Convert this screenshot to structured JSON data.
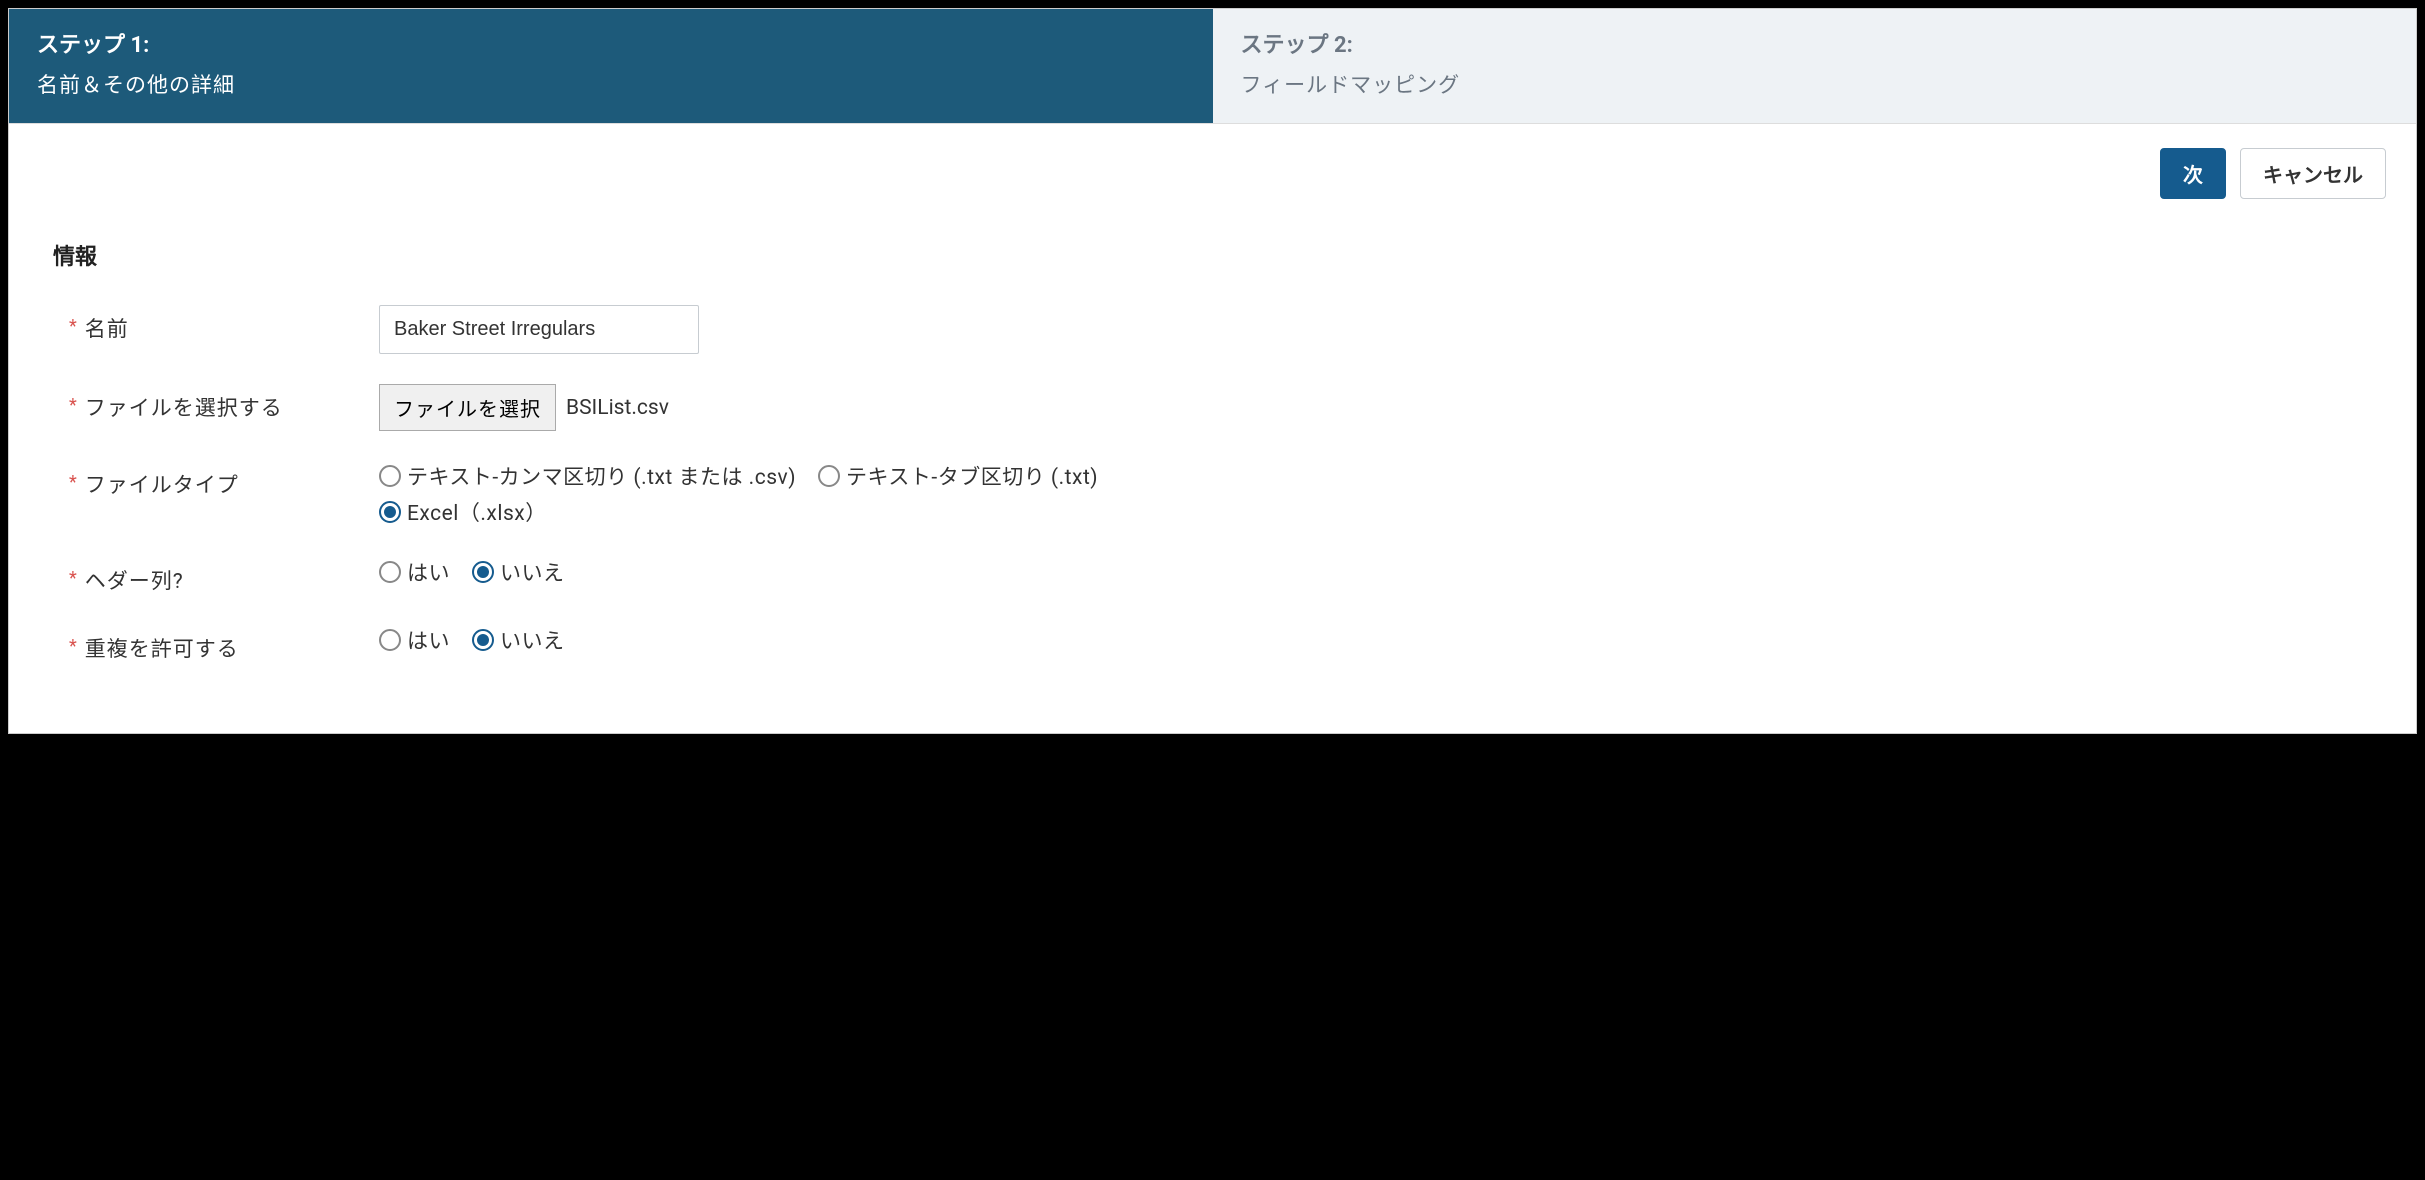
{
  "steps": {
    "step1": {
      "title": "ステップ 1:",
      "subtitle": "名前＆その他の詳細"
    },
    "step2": {
      "title": "ステップ 2:",
      "subtitle": "フィールドマッピング"
    }
  },
  "actions": {
    "next": "次",
    "cancel": "キャンセル"
  },
  "section": {
    "info": "情報"
  },
  "form": {
    "name": {
      "label": "名前",
      "value": "Baker Street Irregulars"
    },
    "file": {
      "label": "ファイルを選択する",
      "button": "ファイルを選択",
      "filename": "BSIList.csv"
    },
    "filetype": {
      "label": "ファイルタイプ",
      "options": {
        "csv": "テキスト-カンマ区切り (.txt または .csv)",
        "tab": "テキスト-タブ区切り (.txt)",
        "xlsx": "Excel（.xlsx）"
      },
      "selected": "xlsx"
    },
    "header": {
      "label": "ヘダー列?",
      "options": {
        "yes": "はい",
        "no": "いいえ"
      },
      "selected": "no"
    },
    "duplicates": {
      "label": "重複を許可する",
      "options": {
        "yes": "はい",
        "no": "いいえ"
      },
      "selected": "no"
    }
  }
}
